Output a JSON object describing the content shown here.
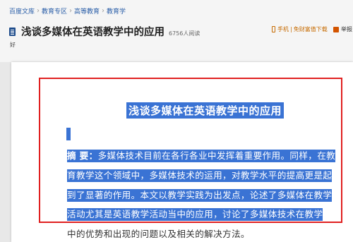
{
  "breadcrumb": [
    "百度文库",
    "教育专区",
    "高等教育",
    "教育学"
  ],
  "breadcrumb_separator": "›",
  "doc": {
    "title": "浅谈多媒体在英语教学中的应用",
    "read_count": "6756人阅读"
  },
  "actions": {
    "phone_label": "手机",
    "download_label": "免财富值下载",
    "report_label": "举报"
  },
  "small_char": "好",
  "content": {
    "heading": "浅谈多媒体在英语教学中的应用",
    "abstract_label": "摘  要：",
    "lines": [
      "多媒体技术目前在各行各业中发挥着重要作用。同样，在教",
      "育教学这个领域中，多媒体技术的运用，对教学水平的提高更是起",
      "到了显著的作用。本文以教学实践为出发点，论述了多媒体在教学",
      "活动尤其是英语教学活动当中的应用，讨论了多媒体技术在教学",
      "中的优势和出现的问题以及相关的解决方法。"
    ]
  },
  "colors": {
    "selection": "#3a73d4",
    "annotation_frame": "#e02020",
    "link": "#2a5ea8"
  }
}
